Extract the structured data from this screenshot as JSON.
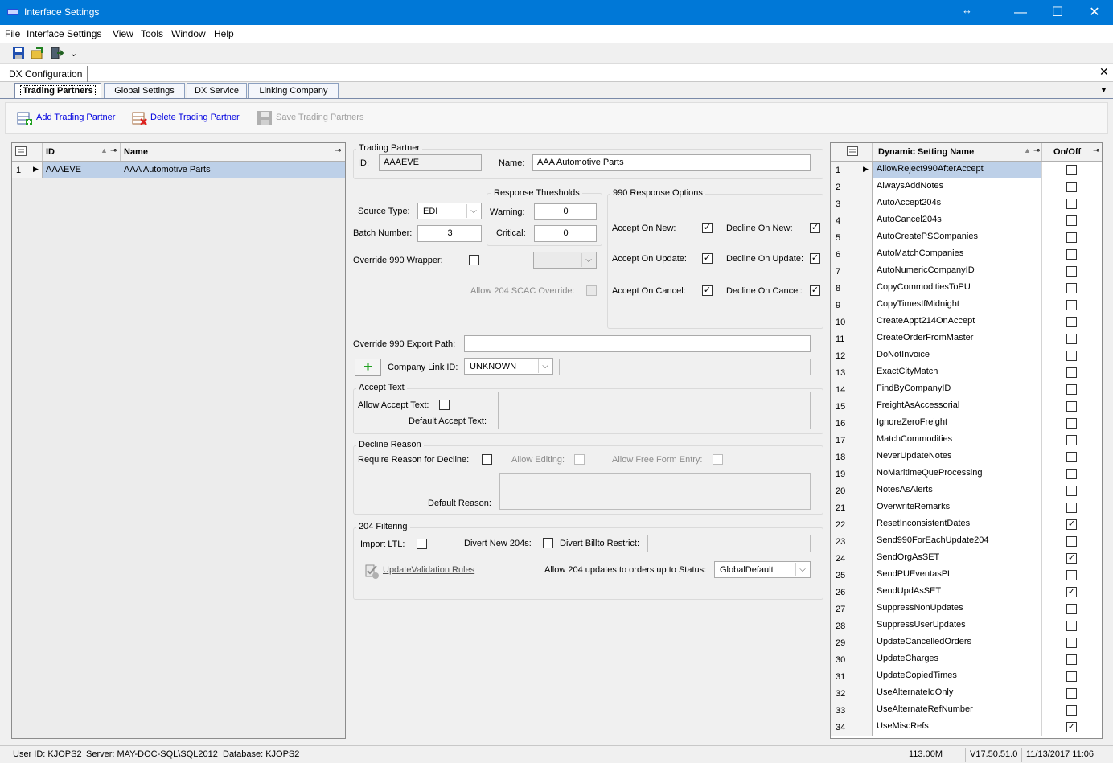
{
  "window": {
    "title": "Interface Settings",
    "resize_glyph": "↔",
    "minimize": "—",
    "maximize": "☐",
    "close": "✕"
  },
  "menu": [
    "File",
    "Interface Settings",
    "View",
    "Tools",
    "Window",
    "Help"
  ],
  "toolbar": {
    "icons": [
      "save-icon",
      "export-icon",
      "exit-icon"
    ],
    "overflow": "⌄"
  },
  "doc_tab": {
    "label": "DX Configuration",
    "close": "✕"
  },
  "tabs": [
    "Trading Partners",
    "Global Settings",
    "DX Service",
    "Linking Company"
  ],
  "actions": {
    "add": "Add Trading Partner",
    "delete": "Delete Trading Partner",
    "save": "Save Trading Partners"
  },
  "left_grid": {
    "columns": [
      "ID",
      "Name"
    ],
    "rows": [
      {
        "num": "1",
        "id": "AAAEVE",
        "name": "AAA Automotive Parts"
      }
    ]
  },
  "trading_partner": {
    "title": "Trading Partner",
    "id_label": "ID:",
    "id_value": "AAAEVE",
    "name_label": "Name:",
    "name_value": "AAA Automotive Parts"
  },
  "source": {
    "source_type_label": "Source Type:",
    "source_type_value": "EDI",
    "batch_label": "Batch Number:",
    "batch_value": "3",
    "override_wrapper_label": "Override 990 Wrapper:",
    "scac_override_label": "Allow 204 SCAC Override:"
  },
  "thresholds": {
    "title": "Response Thresholds",
    "warning_label": "Warning:",
    "warning_value": "0",
    "critical_label": "Critical:",
    "critical_value": "0"
  },
  "response_options": {
    "title": "990 Response Options",
    "accept_new": "Accept On New:",
    "decline_new": "Decline On New:",
    "accept_update": "Accept On Update:",
    "decline_update": "Decline On Update:",
    "accept_cancel": "Accept On Cancel:",
    "decline_cancel": "Decline On Cancel:",
    "check": "✓"
  },
  "export_path": {
    "label": "Override 990 Export Path:",
    "value": ""
  },
  "company_link": {
    "label": "Company Link ID:",
    "value": "UNKNOWN",
    "plus": "+"
  },
  "accept_text": {
    "title": "Accept Text",
    "allow_label": "Allow Accept Text:",
    "default_label": "Default Accept Text:"
  },
  "decline_reason": {
    "title": "Decline Reason",
    "require_label": "Require Reason for Decline:",
    "editing_label": "Allow Editing:",
    "free_form_label": "Allow Free Form Entry:",
    "default_label": "Default Reason:"
  },
  "filtering": {
    "title": "204 Filtering",
    "import_ltl": "Import LTL:",
    "divert_new": "Divert New 204s:",
    "divert_billto": "Divert Billto Restrict:",
    "update_rules": "UpdateValidation Rules",
    "allow_updates_label": "Allow 204 updates to orders up to Status:",
    "status_value": "GlobalDefault"
  },
  "dynamic_settings": {
    "col_name": "Dynamic Setting Name",
    "col_onoff": "On/Off",
    "rows": [
      {
        "num": "1",
        "name": "AllowReject990AfterAccept",
        "on": false
      },
      {
        "num": "2",
        "name": "AlwaysAddNotes",
        "on": false
      },
      {
        "num": "3",
        "name": "AutoAccept204s",
        "on": false
      },
      {
        "num": "4",
        "name": "AutoCancel204s",
        "on": false
      },
      {
        "num": "5",
        "name": "AutoCreatePSCompanies",
        "on": false
      },
      {
        "num": "6",
        "name": "AutoMatchCompanies",
        "on": false
      },
      {
        "num": "7",
        "name": "AutoNumericCompanyID",
        "on": false
      },
      {
        "num": "8",
        "name": "CopyCommoditiesToPU",
        "on": false
      },
      {
        "num": "9",
        "name": "CopyTimesIfMidnight",
        "on": false
      },
      {
        "num": "10",
        "name": "CreateAppt214OnAccept",
        "on": false
      },
      {
        "num": "11",
        "name": "CreateOrderFromMaster",
        "on": false
      },
      {
        "num": "12",
        "name": "DoNotInvoice",
        "on": false
      },
      {
        "num": "13",
        "name": "ExactCityMatch",
        "on": false
      },
      {
        "num": "14",
        "name": "FindByCompanyID",
        "on": false
      },
      {
        "num": "15",
        "name": "FreightAsAccessorial",
        "on": false
      },
      {
        "num": "16",
        "name": "IgnoreZeroFreight",
        "on": false
      },
      {
        "num": "17",
        "name": "MatchCommodities",
        "on": false
      },
      {
        "num": "18",
        "name": "NeverUpdateNotes",
        "on": false
      },
      {
        "num": "19",
        "name": "NoMaritimeQueProcessing",
        "on": false
      },
      {
        "num": "20",
        "name": "NotesAsAlerts",
        "on": false
      },
      {
        "num": "21",
        "name": "OverwriteRemarks",
        "on": false
      },
      {
        "num": "22",
        "name": "ResetInconsistentDates",
        "on": true
      },
      {
        "num": "23",
        "name": "Send990ForEachUpdate204",
        "on": false
      },
      {
        "num": "24",
        "name": "SendOrgAsSET",
        "on": true
      },
      {
        "num": "25",
        "name": "SendPUEventasPL",
        "on": false
      },
      {
        "num": "26",
        "name": "SendUpdAsSET",
        "on": true
      },
      {
        "num": "27",
        "name": "SuppressNonUpdates",
        "on": false
      },
      {
        "num": "28",
        "name": "SuppressUserUpdates",
        "on": false
      },
      {
        "num": "29",
        "name": "UpdateCancelledOrders",
        "on": false
      },
      {
        "num": "30",
        "name": "UpdateCharges",
        "on": false
      },
      {
        "num": "31",
        "name": "UpdateCopiedTimes",
        "on": false
      },
      {
        "num": "32",
        "name": "UseAlternateIdOnly",
        "on": false
      },
      {
        "num": "33",
        "name": "UseAlternateRefNumber",
        "on": false
      },
      {
        "num": "34",
        "name": "UseMiscRefs",
        "on": true
      }
    ]
  },
  "status_bar": {
    "user": "User ID: KJOPS2",
    "server": "Server: MAY-DOC-SQL\\SQL2012",
    "database": "Database: KJOPS2",
    "memory": "113.00M",
    "version": "V17.50.51.0",
    "datetime": "11/13/2017 11:06"
  },
  "colors": {
    "titlebar": "#0078d7",
    "selection": "#bdd0e8",
    "link": "#0000e0"
  }
}
